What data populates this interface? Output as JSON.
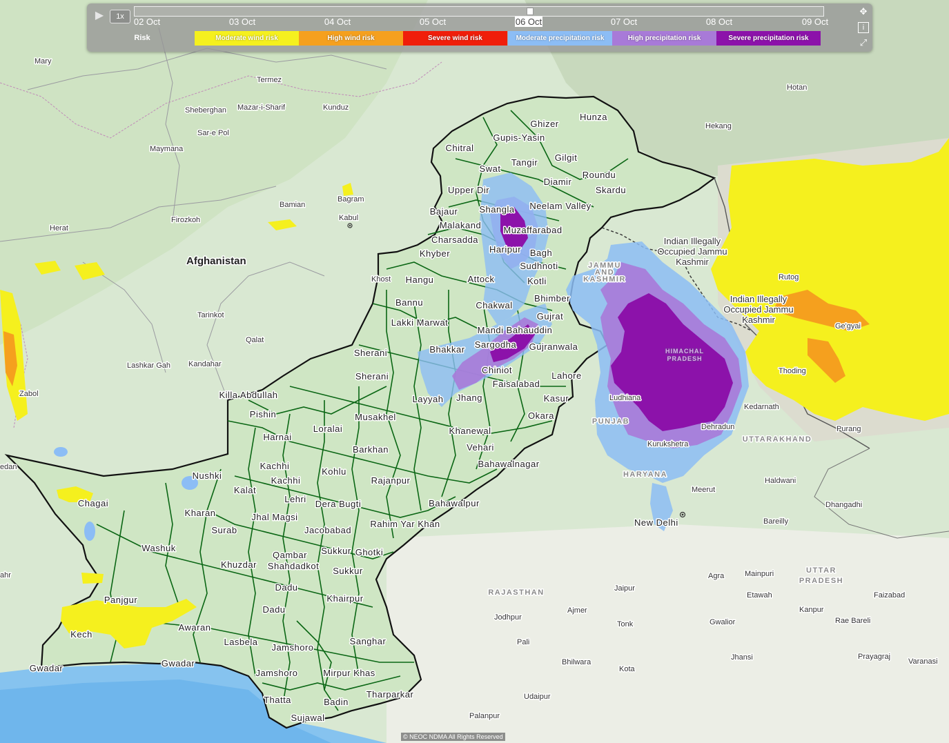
{
  "map": {
    "countries": [
      {
        "id": "afghanistan",
        "name": "Afghanistan"
      }
    ],
    "cities": [
      {
        "id": "mary",
        "name": "Mary"
      },
      {
        "id": "termez",
        "name": "Termez"
      },
      {
        "id": "sheberghan",
        "name": "Sheberghan"
      },
      {
        "id": "mazar",
        "name": "Mazar-i-Sharif"
      },
      {
        "id": "kunduz",
        "name": "Kunduz"
      },
      {
        "id": "sarepol",
        "name": "Sar-e Pol"
      },
      {
        "id": "maymana",
        "name": "Maymana"
      },
      {
        "id": "bamian",
        "name": "Bamian"
      },
      {
        "id": "bagram",
        "name": "Bagram"
      },
      {
        "id": "kabul",
        "name": "Kabul"
      },
      {
        "id": "herat",
        "name": "Herat"
      },
      {
        "id": "firozkoh",
        "name": "Firozkoh"
      },
      {
        "id": "tarinkot",
        "name": "Tarinkot"
      },
      {
        "id": "qalat",
        "name": "Qalat"
      },
      {
        "id": "lashkargah",
        "name": "Lashkar Gah"
      },
      {
        "id": "kandahar",
        "name": "Kandahar"
      },
      {
        "id": "zabol",
        "name": "Zabol"
      },
      {
        "id": "khost",
        "name": "Khost"
      },
      {
        "id": "hotan",
        "name": "Hotan"
      },
      {
        "id": "hekang",
        "name": "Hekang"
      },
      {
        "id": "rutog",
        "name": "Rutog"
      },
      {
        "id": "gegyai",
        "name": "Ge'gyai"
      },
      {
        "id": "thoding",
        "name": "Thoding"
      },
      {
        "id": "purang",
        "name": "Purang"
      },
      {
        "id": "kedarnath",
        "name": "Kedarnath"
      },
      {
        "id": "dehradun",
        "name": "Dehradun"
      },
      {
        "id": "kurukshetra",
        "name": "Kurukshetra"
      },
      {
        "id": "ludhiana",
        "name": "Ludhiana"
      },
      {
        "id": "haldwani",
        "name": "Haldwani"
      },
      {
        "id": "meerut",
        "name": "Meerut"
      },
      {
        "id": "newdelhi",
        "name": "New Delhi"
      },
      {
        "id": "dhangadhi",
        "name": "Dhangadhi"
      },
      {
        "id": "bareilly",
        "name": "Bareilly"
      },
      {
        "id": "agra",
        "name": "Agra"
      },
      {
        "id": "mainpuri",
        "name": "Mainpuri"
      },
      {
        "id": "etawah",
        "name": "Etawah"
      },
      {
        "id": "faizabad",
        "name": "Faizabad"
      },
      {
        "id": "kanpur",
        "name": "Kanpur"
      },
      {
        "id": "raebareli",
        "name": "Rae Bareli"
      },
      {
        "id": "jaipur",
        "name": "Jaipur"
      },
      {
        "id": "ajmer",
        "name": "Ajmer"
      },
      {
        "id": "jodhpur",
        "name": "Jodhpur"
      },
      {
        "id": "tonk",
        "name": "Tonk"
      },
      {
        "id": "gwalior",
        "name": "Gwalior"
      },
      {
        "id": "pali",
        "name": "Pali"
      },
      {
        "id": "bhilwara",
        "name": "Bhilwara"
      },
      {
        "id": "jhansi",
        "name": "Jhansi"
      },
      {
        "id": "prayagraj",
        "name": "Prayagraj"
      },
      {
        "id": "varanasi",
        "name": "Varanasi"
      },
      {
        "id": "kota",
        "name": "Kota"
      },
      {
        "id": "udaipur",
        "name": "Udaipur"
      },
      {
        "id": "palanpur",
        "name": "Palanpur"
      },
      {
        "id": "edan",
        "name": "edan"
      },
      {
        "id": "ahr",
        "name": "ahr"
      }
    ],
    "regions": [
      {
        "id": "himachal",
        "name": "HIMACHAL PRADESH"
      },
      {
        "id": "jk",
        "name": "JAMMU AND KASHMIR"
      },
      {
        "id": "punjab",
        "name": "PUNJAB"
      },
      {
        "id": "haryana",
        "name": "HARYANA"
      },
      {
        "id": "uttarakhand",
        "name": "UTTARAKHAND"
      },
      {
        "id": "rajasthan",
        "name": "RAJASTHAN"
      },
      {
        "id": "up",
        "name": "UTTAR PRADESH"
      },
      {
        "id": "iojk1",
        "name": "Indian Illegally Occupied Jammu Kashmir"
      },
      {
        "id": "iojk2",
        "name": "Indian Illegally Occupied Jammu Kashmir"
      }
    ],
    "districts": [
      "Hunza",
      "Ghizer",
      "Gupis-Yasin",
      "Chitral",
      "Tangir",
      "Gilgit",
      "Swat",
      "Roundu",
      "Diamir",
      "Skardu",
      "Upper Dir",
      "Shangla",
      "Neelam Valley",
      "Bajaur",
      "Malakand",
      "Muzaffarabad",
      "Charsadda",
      "Haripur",
      "Bagh",
      "Khyber",
      "Sudhnoti",
      "Hangu",
      "Attock",
      "Kotli",
      "Bannu",
      "Chakwal",
      "Bhimber",
      "Gujrat",
      "Lakki Marwat",
      "Mandi Bahauddin",
      "Sargodha",
      "Gujranwala",
      "Bhakkar",
      "Sherani",
      "Chiniot",
      "Lahore",
      "Faisalabad",
      "Layyah",
      "Jhang",
      "Kasur",
      "Killa Abdullah",
      "Okara",
      "Pishin",
      "Musakhel",
      "Loralai",
      "Harnai",
      "Khanewal",
      "Barkhan",
      "Vehari",
      "Nushki",
      "Kachhi",
      "Bahawalnagar",
      "Kohlu",
      "Chagai",
      "Kalat",
      "Rajanpur",
      "Lehri",
      "Kharan",
      "Jhal Magsi",
      "Dera Bugti",
      "Bahawalpur",
      "Surab",
      "Rahim Yar Khan",
      "Jacobabad",
      "Washuk",
      "Qambar",
      "Sukkur",
      "Ghotki",
      "Khuzdar",
      "Shahdadkot",
      "Dadu",
      "Panjgur",
      "Khairpur",
      "Awaran",
      "Kech",
      "Lasbela",
      "Jamshoro",
      "Sanghar",
      "Gwadar",
      "Mirpur Khas",
      "Tharparkar",
      "Thatta",
      "Badin",
      "Sujawal"
    ],
    "colors": {
      "moderate_wind": "#f5f01e",
      "high_wind": "#f5a01e",
      "severe_wind": "#f01e0a",
      "moderate_precip": "#8cbdf5",
      "high_precip": "#a87ad8",
      "severe_precip": "#8c12aa",
      "pakistan_fill": "#cfe6c4",
      "district_line": "#0a6614",
      "border_line": "#111111"
    }
  },
  "timeline": {
    "play_icon": "play-icon",
    "speed": "1x",
    "dates": [
      "02 Oct",
      "03 Oct",
      "04 Oct",
      "05 Oct",
      "06 Oct",
      "07 Oct",
      "08 Oct",
      "09 Oct"
    ],
    "active_date": "06 Oct",
    "legend_title": "Risk",
    "legend": [
      {
        "label": "Moderate wind risk",
        "color": "#f5f01e"
      },
      {
        "label": "High wind risk",
        "color": "#f5a01e"
      },
      {
        "label": "Severe wind risk",
        "color": "#f01e0a"
      },
      {
        "label": "Moderate precipitation risk",
        "color": "#8cbdf5"
      },
      {
        "label": "High precipitation risk",
        "color": "#a87ad8"
      },
      {
        "label": "Severe precipitation risk",
        "color": "#8c12aa"
      }
    ],
    "controls": {
      "move": "move-icon",
      "info": "i",
      "expand": "expand-icon"
    }
  },
  "attribution": "© NEOC NDMA All Rights Reserved"
}
